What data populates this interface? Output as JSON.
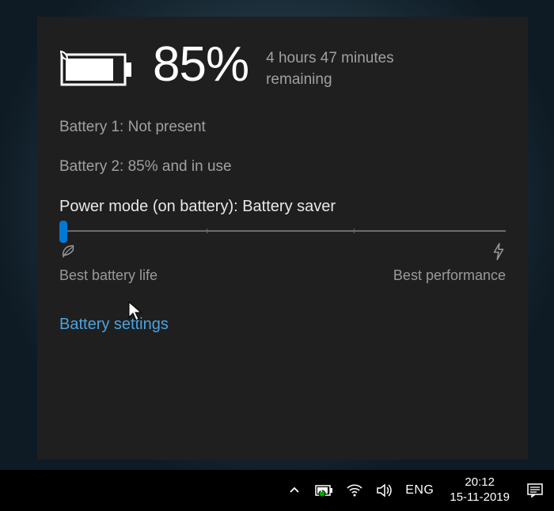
{
  "flyout": {
    "percent": "85%",
    "remaining": "4 hours 47 minutes remaining",
    "battery1": "Battery 1: Not present",
    "battery2": "Battery 2: 85% and in use",
    "powerModeLabel": "Power mode (on battery): Battery saver",
    "slider": {
      "leftLabel": "Best battery life",
      "rightLabel": "Best performance"
    },
    "settingsLink": "Battery settings"
  },
  "taskbar": {
    "lang": "ENG",
    "time": "20:12",
    "date": "15-11-2019"
  },
  "colors": {
    "accent": "#0078d4",
    "link": "#4aa3df"
  }
}
